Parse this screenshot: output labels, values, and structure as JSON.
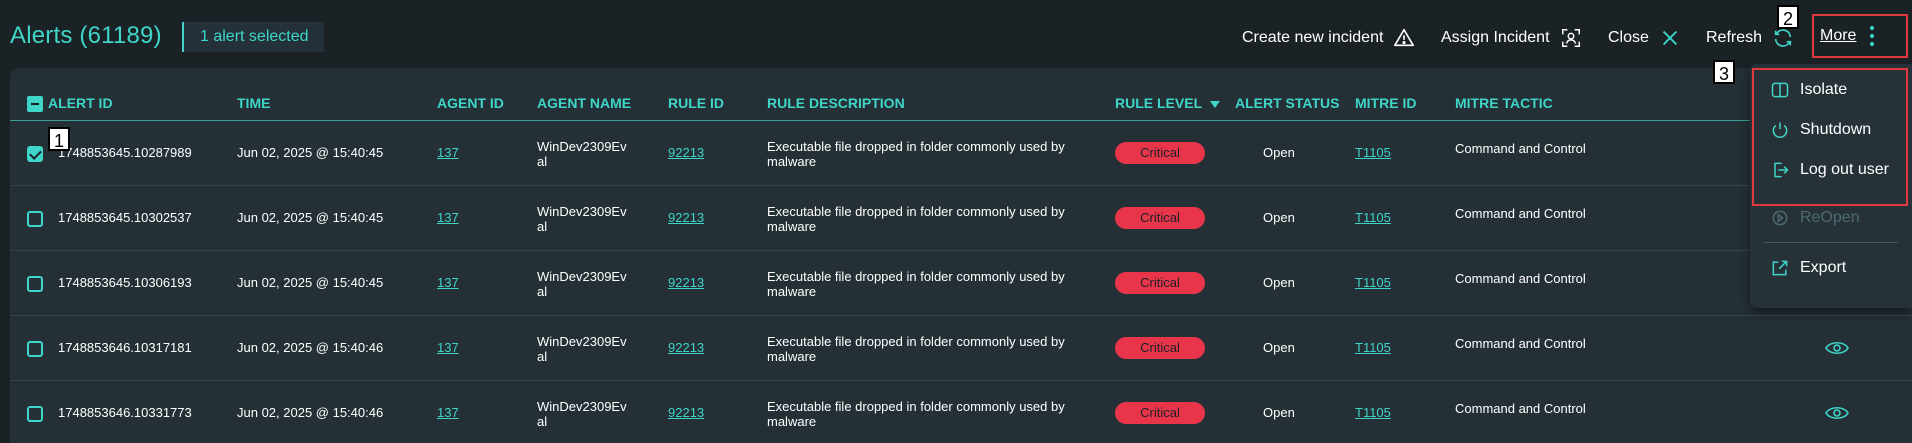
{
  "header": {
    "title": "Alerts (61189)",
    "selected_badge": "1 alert selected",
    "actions": {
      "create_incident": "Create new incident",
      "assign_incident": "Assign Incident",
      "close": "Close",
      "refresh": "Refresh",
      "more": "More"
    }
  },
  "markers": {
    "m1": "1",
    "m2": "2",
    "m3": "3"
  },
  "table": {
    "columns": {
      "alert_id": "ALERT ID",
      "time": "TIME",
      "agent_id": "AGENT ID",
      "agent_name": "AGENT NAME",
      "rule_id": "RULE ID",
      "rule_description": "RULE DESCRIPTION",
      "rule_level": "RULE LEVEL",
      "alert_status": "ALERT STATUS",
      "mitre_id": "MITRE ID",
      "mitre_tactic": "MITRE TACTIC"
    },
    "rows": [
      {
        "alert_id": "1748853645.10287989",
        "time": "Jun 02, 2025 @ 15:40:45",
        "agent_id": "137",
        "agent_name": "WinDev2309Ev al",
        "rule_id": "92213",
        "rule_description": "Executable file dropped in folder commonly used by malware",
        "rule_level": "Critical",
        "alert_status": "Open",
        "mitre_id": "T1105",
        "mitre_tactic": "Command and Control",
        "checked": true
      },
      {
        "alert_id": "1748853645.10302537",
        "time": "Jun 02, 2025 @ 15:40:45",
        "agent_id": "137",
        "agent_name": "WinDev2309Ev al",
        "rule_id": "92213",
        "rule_description": "Executable file dropped in folder commonly used by malware",
        "rule_level": "Critical",
        "alert_status": "Open",
        "mitre_id": "T1105",
        "mitre_tactic": "Command and Control",
        "checked": false
      },
      {
        "alert_id": "1748853645.10306193",
        "time": "Jun 02, 2025 @ 15:40:45",
        "agent_id": "137",
        "agent_name": "WinDev2309Ev al",
        "rule_id": "92213",
        "rule_description": "Executable file dropped in folder commonly used by malware",
        "rule_level": "Critical",
        "alert_status": "Open",
        "mitre_id": "T1105",
        "mitre_tactic": "Command and Control",
        "checked": false
      },
      {
        "alert_id": "1748853646.10317181",
        "time": "Jun 02, 2025 @ 15:40:46",
        "agent_id": "137",
        "agent_name": "WinDev2309Ev al",
        "rule_id": "92213",
        "rule_description": "Executable file dropped in folder commonly used by malware",
        "rule_level": "Critical",
        "alert_status": "Open",
        "mitre_id": "T1105",
        "mitre_tactic": "Command and Control",
        "checked": false
      },
      {
        "alert_id": "1748853646.10331773",
        "time": "Jun 02, 2025 @ 15:40:46",
        "agent_id": "137",
        "agent_name": "WinDev2309Ev al",
        "rule_id": "92213",
        "rule_description": "Executable file dropped in folder commonly used by malware",
        "rule_level": "Critical",
        "alert_status": "Open",
        "mitre_id": "T1105",
        "mitre_tactic": "Command and Control",
        "checked": false
      }
    ]
  },
  "more_menu": {
    "isolate": "Isolate",
    "shutdown": "Shutdown",
    "logout": "Log out user",
    "reopen": "ReOpen",
    "export": "Export"
  },
  "colors": {
    "accent": "#3fd5c9",
    "critical": "#e8354a",
    "highlight": "#e0393f",
    "background": "#1b2226"
  },
  "icons": [
    "warning-icon",
    "assign-icon",
    "close-icon",
    "refresh-icon",
    "kebab-icon",
    "isolate-icon",
    "power-icon",
    "logout-icon",
    "reopen-icon",
    "export-icon",
    "eye-icon"
  ]
}
